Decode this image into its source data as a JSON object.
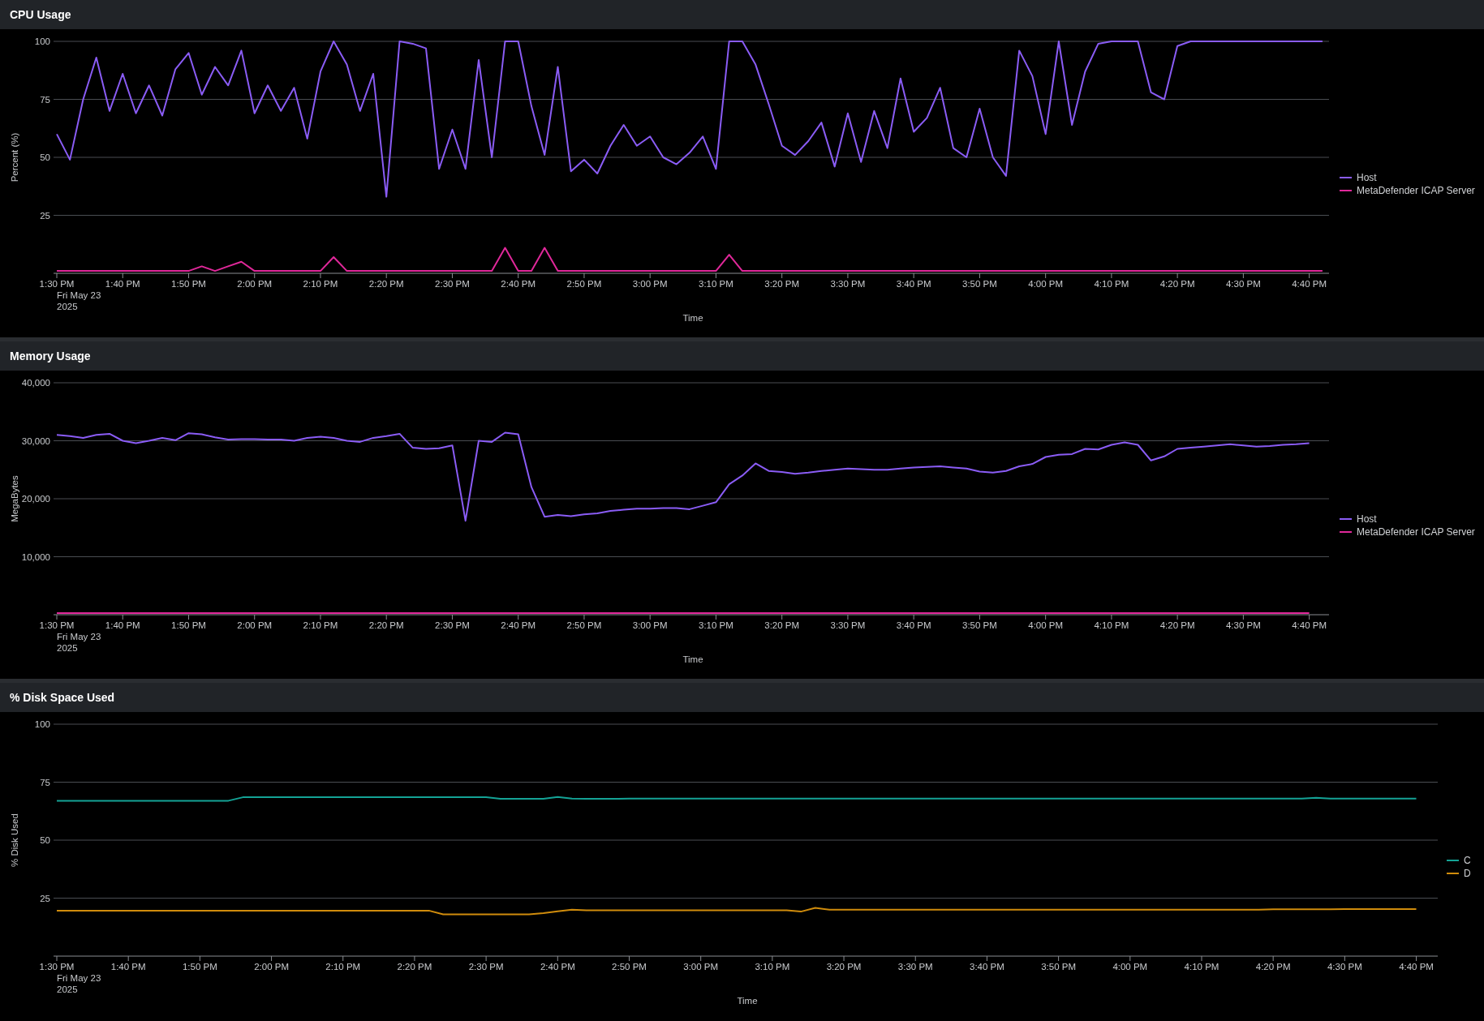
{
  "panels": [
    {
      "title": "CPU Usage",
      "date_lines": [
        "Fri May 23",
        "2025"
      ],
      "chart_data": {
        "type": "line",
        "grid": true,
        "xlabel": "Time",
        "ylabel": "Percent (%)",
        "ylim": [
          0,
          100
        ],
        "yticks": [
          25,
          50,
          75,
          100
        ],
        "categories": [
          "1:30 PM",
          null,
          null,
          null,
          null,
          "1:40 PM",
          null,
          null,
          null,
          null,
          "1:50 PM",
          null,
          null,
          null,
          null,
          "2:00 PM",
          null,
          null,
          null,
          null,
          "2:10 PM",
          null,
          null,
          null,
          null,
          "2:20 PM",
          null,
          null,
          null,
          null,
          "2:30 PM",
          null,
          null,
          null,
          null,
          "2:40 PM",
          null,
          null,
          null,
          null,
          "2:50 PM",
          null,
          null,
          null,
          null,
          "3:00 PM",
          null,
          null,
          null,
          null,
          "3:10 PM",
          null,
          null,
          null,
          null,
          "3:20 PM",
          null,
          null,
          null,
          null,
          "3:30 PM",
          null,
          null,
          null,
          null,
          "3:40 PM",
          null,
          null,
          null,
          null,
          "3:50 PM",
          null,
          null,
          null,
          null,
          "4:00 PM",
          null,
          null,
          null,
          null,
          "4:10 PM",
          null,
          null,
          null,
          null,
          "4:20 PM",
          null,
          null,
          null,
          null,
          "4:30 PM",
          null,
          null,
          null,
          null,
          "4:40 PM",
          null
        ],
        "series": [
          {
            "name": "Host",
            "color": "#8a5cf5",
            "values": [
              60,
              49,
              75,
              93,
              70,
              86,
              69,
              81,
              68,
              88,
              95,
              77,
              89,
              81,
              96,
              69,
              81,
              70,
              80,
              58,
              87,
              100,
              90,
              70,
              86,
              33,
              100,
              99,
              97,
              45,
              62,
              45,
              92,
              50,
              100,
              100,
              72,
              51,
              89,
              44,
              49,
              43,
              55,
              64,
              55,
              59,
              50,
              47,
              52,
              59,
              45,
              100,
              100,
              90,
              73,
              55,
              51,
              57,
              65,
              46,
              69,
              48,
              70,
              54,
              84,
              61,
              67,
              80,
              54,
              50,
              71,
              50,
              42,
              96,
              85,
              60,
              100,
              64,
              87,
              99,
              100,
              100,
              100,
              78,
              75,
              98,
              100,
              100,
              100,
              100,
              100,
              100,
              100,
              100,
              100,
              100,
              100
            ]
          },
          {
            "name": "MetaDefender ICAP Server",
            "color": "#e0289a",
            "values": [
              1,
              1,
              1,
              1,
              1,
              1,
              1,
              1,
              1,
              1,
              1,
              3,
              1,
              3,
              5,
              1,
              1,
              1,
              1,
              1,
              1,
              7,
              1,
              1,
              1,
              1,
              1,
              1,
              1,
              1,
              1,
              1,
              1,
              1,
              11,
              1,
              1,
              11,
              1,
              1,
              1,
              1,
              1,
              1,
              1,
              1,
              1,
              1,
              1,
              1,
              1,
              8,
              1,
              1,
              1,
              1,
              1,
              1,
              1,
              1,
              1,
              1,
              1,
              1,
              1,
              1,
              1,
              1,
              1,
              1,
              1,
              1,
              1,
              1,
              1,
              1,
              1,
              1,
              1,
              1,
              1,
              1,
              1,
              1,
              1,
              1,
              1,
              1,
              1,
              1,
              1,
              1,
              1,
              1,
              1,
              1,
              1
            ]
          }
        ]
      }
    },
    {
      "title": "Memory Usage",
      "date_lines": [
        "Fri May 23",
        "2025"
      ],
      "chart_data": {
        "type": "line",
        "grid": true,
        "xlabel": "Time",
        "ylabel": "MegaBytes",
        "ylim": [
          0,
          40000
        ],
        "yticks": [
          {
            "value": 10000,
            "label": "10,000"
          },
          {
            "value": 20000,
            "label": "20,000"
          },
          {
            "value": 30000,
            "label": "30,000"
          },
          {
            "value": 40000,
            "label": "40,000"
          }
        ],
        "categories": [
          "1:30 PM",
          null,
          null,
          null,
          null,
          "1:40 PM",
          null,
          null,
          null,
          null,
          "1:50 PM",
          null,
          null,
          null,
          null,
          "2:00 PM",
          null,
          null,
          null,
          null,
          "2:10 PM",
          null,
          null,
          null,
          null,
          "2:20 PM",
          null,
          null,
          null,
          null,
          "2:30 PM",
          null,
          null,
          null,
          null,
          "2:40 PM",
          null,
          null,
          null,
          null,
          "2:50 PM",
          null,
          null,
          null,
          null,
          "3:00 PM",
          null,
          null,
          null,
          null,
          "3:10 PM",
          null,
          null,
          null,
          null,
          "3:20 PM",
          null,
          null,
          null,
          null,
          "3:30 PM",
          null,
          null,
          null,
          null,
          "3:40 PM",
          null,
          null,
          null,
          null,
          "3:50 PM",
          null,
          null,
          null,
          null,
          "4:00 PM",
          null,
          null,
          null,
          null,
          "4:10 PM",
          null,
          null,
          null,
          null,
          "4:20 PM",
          null,
          null,
          null,
          null,
          "4:30 PM",
          null,
          null,
          null,
          null,
          "4:40 PM",
          null
        ],
        "series": [
          {
            "name": "Host",
            "color": "#8a5cf5",
            "values": [
              31000,
              30800,
              30500,
              31000,
              31200,
              30000,
              29600,
              30000,
              30500,
              30100,
              31300,
              31100,
              30600,
              30200,
              30300,
              30300,
              30200,
              30200,
              30000,
              30500,
              30700,
              30500,
              30000,
              29800,
              30500,
              30800,
              31200,
              28800,
              28600,
              28700,
              29200,
              16200,
              30000,
              29800,
              31400,
              31100,
              22000,
              16900,
              17200,
              17000,
              17300,
              17500,
              17900,
              18100,
              18300,
              18300,
              18400,
              18400,
              18200,
              18800,
              19400,
              22500,
              24000,
              26100,
              24800,
              24600,
              24300,
              24500,
              24800,
              25000,
              25200,
              25100,
              25000,
              25000,
              25200,
              25400,
              25500,
              25600,
              25400,
              25200,
              24700,
              24500,
              24800,
              25600,
              26000,
              27200,
              27600,
              27700,
              28600,
              28500,
              29300,
              29700,
              29300,
              26600,
              27300,
              28600,
              28800,
              29000,
              29200,
              29400,
              29200,
              29000,
              29100,
              29300,
              29400,
              29600,
              null
            ]
          },
          {
            "name": "MetaDefender ICAP Server",
            "color": "#e0289a",
            "values": [
              300,
              300,
              300,
              300,
              300,
              300,
              300,
              300,
              300,
              300,
              300,
              300,
              300,
              300,
              300,
              300,
              300,
              300,
              300,
              300,
              300,
              300,
              300,
              300,
              300,
              300,
              300,
              300,
              300,
              300,
              300,
              300,
              300,
              300,
              300,
              300,
              300,
              300,
              300,
              300,
              300,
              300,
              300,
              300,
              300,
              300,
              300,
              300,
              300,
              300,
              300,
              300,
              300,
              300,
              300,
              300,
              300,
              300,
              300,
              300,
              300,
              300,
              300,
              300,
              300,
              300,
              300,
              300,
              300,
              300,
              300,
              300,
              300,
              300,
              300,
              300,
              300,
              300,
              300,
              300,
              300,
              300,
              300,
              300,
              300,
              300,
              300,
              300,
              300,
              300,
              300,
              300,
              300,
              300,
              300,
              300,
              null
            ]
          }
        ]
      }
    },
    {
      "title": "% Disk Space Used",
      "date_lines": [
        "Fri May 23",
        "2025"
      ],
      "chart_data": {
        "type": "line",
        "grid": true,
        "xlabel": "Time",
        "ylabel": "% Disk Used",
        "ylim": [
          0,
          100
        ],
        "yticks": [
          25,
          50,
          75,
          100
        ],
        "categories": [
          "1:30 PM",
          null,
          null,
          null,
          null,
          "1:40 PM",
          null,
          null,
          null,
          null,
          "1:50 PM",
          null,
          null,
          null,
          null,
          "2:00 PM",
          null,
          null,
          null,
          null,
          "2:10 PM",
          null,
          null,
          null,
          null,
          "2:20 PM",
          null,
          null,
          null,
          null,
          "2:30 PM",
          null,
          null,
          null,
          null,
          "2:40 PM",
          null,
          null,
          null,
          null,
          "2:50 PM",
          null,
          null,
          null,
          null,
          "3:00 PM",
          null,
          null,
          null,
          null,
          "3:10 PM",
          null,
          null,
          null,
          null,
          "3:20 PM",
          null,
          null,
          null,
          null,
          "3:30 PM",
          null,
          null,
          null,
          null,
          "3:40 PM",
          null,
          null,
          null,
          null,
          "3:50 PM",
          null,
          null,
          null,
          null,
          "4:00 PM",
          null,
          null,
          null,
          null,
          "4:10 PM",
          null,
          null,
          null,
          null,
          "4:20 PM",
          null,
          null,
          null,
          null,
          "4:30 PM",
          null,
          null,
          null,
          null,
          "4:40 PM",
          null
        ],
        "series": [
          {
            "name": "C",
            "color": "#14a396",
            "values": [
              67,
              67,
              67,
              67,
              67,
              67,
              67,
              67,
              67,
              67,
              67,
              67,
              67,
              68.5,
              68.5,
              68.5,
              68.5,
              68.5,
              68.5,
              68.5,
              68.5,
              68.5,
              68.5,
              68.5,
              68.5,
              68.5,
              68.5,
              68.5,
              68.5,
              68.5,
              68.5,
              67.8,
              67.8,
              67.8,
              67.8,
              68.6,
              67.9,
              67.8,
              67.8,
              67.8,
              67.9,
              67.9,
              67.9,
              67.9,
              67.9,
              67.9,
              67.9,
              67.9,
              67.9,
              67.9,
              67.9,
              67.9,
              67.9,
              67.9,
              67.9,
              67.9,
              67.9,
              67.9,
              67.9,
              67.9,
              67.9,
              67.9,
              67.9,
              67.9,
              67.9,
              67.9,
              67.9,
              67.9,
              67.9,
              67.9,
              67.9,
              67.9,
              67.9,
              67.9,
              67.9,
              67.9,
              67.9,
              67.9,
              67.9,
              67.9,
              67.9,
              67.9,
              67.9,
              67.9,
              67.9,
              67.9,
              67.9,
              67.9,
              68.3,
              67.9,
              67.9,
              67.9,
              67.9,
              67.9,
              67.9,
              67.9,
              null
            ]
          },
          {
            "name": "D",
            "color": "#d08c0c",
            "values": [
              19.6,
              19.6,
              19.6,
              19.6,
              19.6,
              19.6,
              19.6,
              19.6,
              19.6,
              19.6,
              19.6,
              19.6,
              19.6,
              19.6,
              19.6,
              19.6,
              19.6,
              19.6,
              19.6,
              19.6,
              19.6,
              19.6,
              19.6,
              19.6,
              19.6,
              19.6,
              19.6,
              18,
              18,
              18,
              18,
              18,
              18,
              18,
              18.5,
              19.3,
              20,
              19.8,
              19.8,
              19.8,
              19.8,
              19.8,
              19.8,
              19.8,
              19.8,
              19.8,
              19.8,
              19.8,
              19.8,
              19.8,
              19.8,
              19.8,
              19.2,
              20.8,
              20,
              20,
              20,
              20,
              20,
              20,
              20,
              20,
              20,
              20,
              20,
              20,
              20,
              20,
              20,
              20,
              20,
              20,
              20,
              20,
              20,
              20,
              20,
              20,
              20,
              20,
              20,
              20,
              20,
              20,
              20,
              20.2,
              20.2,
              20.2,
              20.2,
              20.2,
              20.3,
              20.3,
              20.3,
              20.3,
              20.3,
              20.3,
              null
            ]
          }
        ]
      }
    }
  ]
}
